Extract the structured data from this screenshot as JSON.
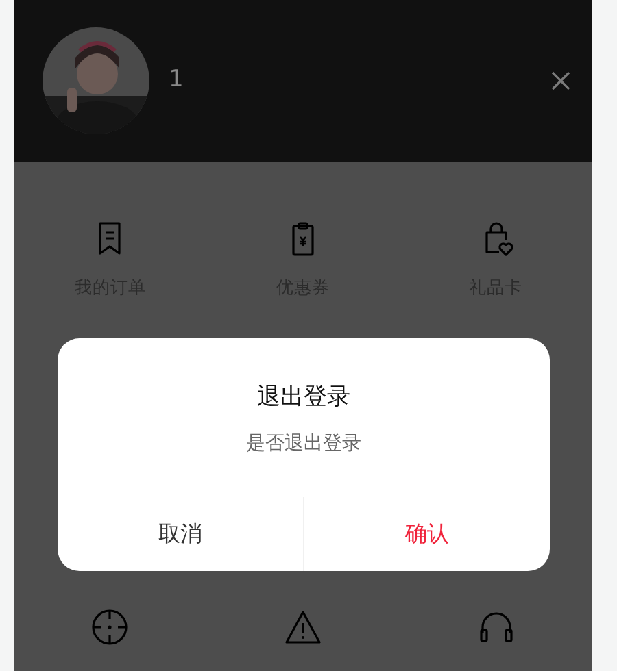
{
  "header": {
    "username": "1"
  },
  "menu_rows": [
    {
      "items": [
        {
          "label": "我的订单",
          "kind": "bookmark"
        },
        {
          "label": "优惠券",
          "kind": "coupon"
        },
        {
          "label": "礼品卡",
          "kind": "giftbag"
        }
      ]
    },
    {
      "items": [
        {
          "kind": "target"
        },
        {
          "kind": "warning"
        },
        {
          "kind": "headset"
        }
      ]
    }
  ],
  "dialog": {
    "title": "退出登录",
    "message": "是否退出登录",
    "buttons": [
      {
        "label": "取消",
        "kind": "cancel"
      },
      {
        "label": "确认",
        "kind": "confirm"
      }
    ]
  }
}
